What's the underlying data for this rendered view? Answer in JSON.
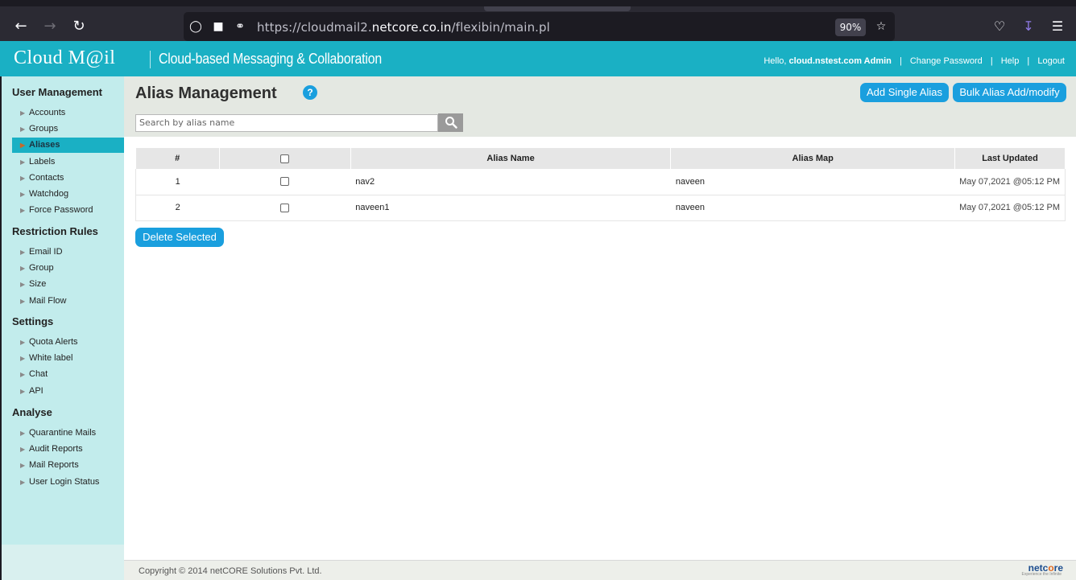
{
  "browser": {
    "url_prefix": "https://cloudmail2.",
    "url_domain": "netcore.co.in",
    "url_suffix": "/flexibin/main.pl",
    "zoom": "90%"
  },
  "header": {
    "logo": "Cloud M@il",
    "tagline": "Cloud-based Messaging & Collaboration",
    "hello": "Hello,",
    "user": "cloud.nstest.com Admin",
    "change_password": "Change Password",
    "help": "Help",
    "logout": "Logout"
  },
  "sidebar": {
    "sections": [
      {
        "title": "User Management",
        "items": [
          "Accounts",
          "Groups",
          "Aliases",
          "Labels",
          "Contacts",
          "Watchdog",
          "Force Password"
        ]
      },
      {
        "title": "Restriction Rules",
        "items": [
          "Email ID",
          "Group",
          "Size",
          "Mail Flow"
        ]
      },
      {
        "title": "Settings",
        "items": [
          "Quota Alerts",
          "White label",
          "Chat",
          "API"
        ]
      },
      {
        "title": "Analyse",
        "items": [
          "Quarantine Mails",
          "Audit Reports",
          "Mail Reports",
          "User Login Status"
        ]
      }
    ],
    "active": "Aliases"
  },
  "main": {
    "title": "Alias Management",
    "help_glyph": "?",
    "add_single_label": "Add Single Alias",
    "bulk_label": "Bulk Alias Add/modify",
    "search_placeholder": "Search by alias name",
    "delete_label": "Delete Selected",
    "table": {
      "columns": [
        "#",
        "",
        "Alias Name",
        "Alias Map",
        "Last Updated"
      ],
      "rows": [
        {
          "num": "1",
          "alias": "nav2",
          "map": "naveen",
          "updated": "May 07,2021 @05:12 PM"
        },
        {
          "num": "2",
          "alias": "naveen1",
          "map": "naveen",
          "updated": "May 07,2021 @05:12 PM"
        }
      ]
    }
  },
  "footer": {
    "copyright": "Copyright © 2014 netCORE Solutions Pvt. Ltd.",
    "brand_a": "netc",
    "brand_o": "o",
    "brand_b": "re",
    "brand_tag": "Experience the Infinite"
  },
  "colors": {
    "accent": "#1ab0c4",
    "button": "#1a9fde",
    "sidebar_bg": "#c2ecec"
  }
}
